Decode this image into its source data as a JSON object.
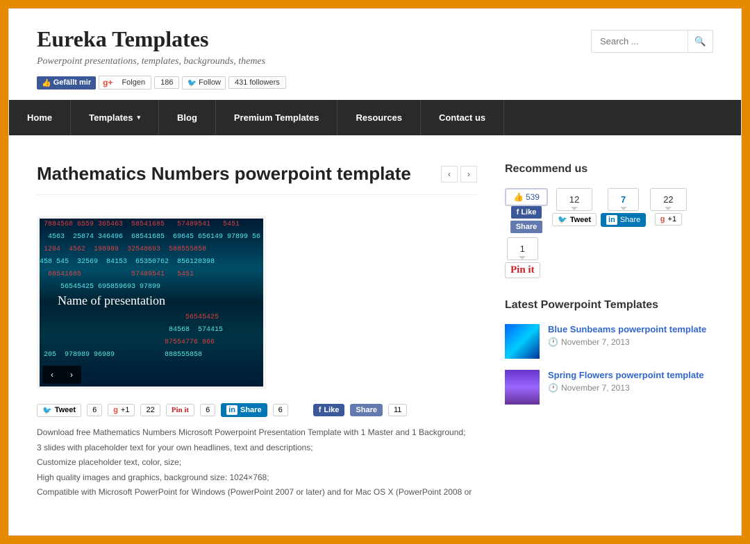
{
  "site": {
    "title": "Eureka Templates",
    "tagline": "Powerpoint presentations, templates, backgrounds, themes"
  },
  "social": {
    "fb_like": "Gefällt mir",
    "gplus_follow": "Folgen",
    "gplus_count": "186",
    "tw_follow": "Follow",
    "tw_followers": "431 followers"
  },
  "search": {
    "placeholder": "Search ..."
  },
  "nav": [
    "Home",
    "Templates",
    "Blog",
    "Premium Templates",
    "Resources",
    "Contact us"
  ],
  "page": {
    "title": "Mathematics Numbers powerpoint template",
    "preview_title": "Name of presentation"
  },
  "share": {
    "tweet": "Tweet",
    "tweet_count": "6",
    "gplus": "+1",
    "gplus_count": "22",
    "pinit": "Pin it",
    "pinit_count": "6",
    "linkedin": "Share",
    "linkedin_count": "6",
    "fblike": "Like",
    "fbshare": "Share",
    "fbcount": "11"
  },
  "description": [
    "Download free Mathematics Numbers Microsoft Powerpoint Presentation Template with 1 Master and 1 Background;",
    "3 slides with placeholder text for your own headlines, text and descriptions;",
    "Customize placeholder text, color, size;",
    "High quality images and graphics, background size: 1024×768;",
    "Compatible with Microsoft PowerPoint for Windows (PowerPoint 2007 or later) and for Mac OS X (PowerPoint 2008 or"
  ],
  "sidebar": {
    "recommend_title": "Recommend us",
    "rec": {
      "fb_thumb_count": "539",
      "fb_like": "Like",
      "fb_share": "Share",
      "tw_count": "12",
      "tw_label": "Tweet",
      "li_count": "7",
      "li_label": "Share",
      "gp_count": "22",
      "gp_label": "+1",
      "pin_count": "1",
      "pin_label": "Pin it"
    },
    "latest_title": "Latest Powerpoint Templates",
    "latest": [
      {
        "title": "Blue Sunbeams powerpoint template",
        "date": "November 7, 2013"
      },
      {
        "title": "Spring Flowers powerpoint template",
        "date": "November 7, 2013"
      }
    ]
  }
}
